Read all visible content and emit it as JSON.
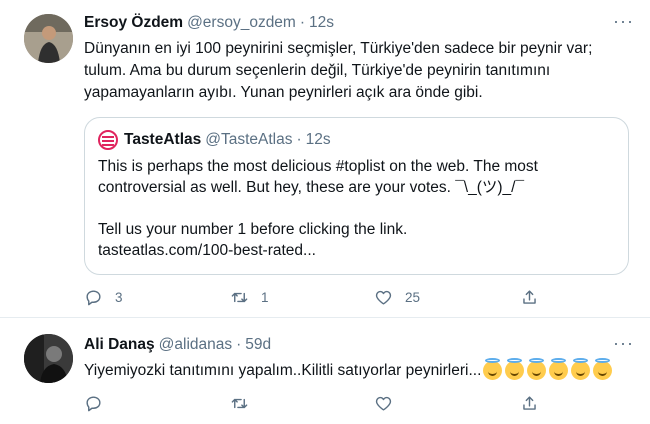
{
  "tweets": [
    {
      "author": {
        "name": "Ersoy Özdem",
        "handle": "@ersoy_ozdem",
        "time": "12s"
      },
      "separator": "·",
      "more": "···",
      "text": "Dünyanın en iyi 100 peynirini seçmişler, Türkiye'den sadece bir peynir var; tulum. Ama bu durum seçenlerin değil, Türkiye'de peynirin tanıtımını yapamayanların ayıbı. Yunan peynirleri açık ara önde gibi.",
      "quote": {
        "author": {
          "name": "TasteAtlas",
          "handle": "@TasteAtlas",
          "time": "12s"
        },
        "lines": [
          "This is perhaps the most delicious #toplist on the web. The most",
          "controversial as well. But hey, these are your votes. ¯\\_(ツ)_/¯",
          "",
          "Tell us your number 1 before clicking the link.",
          "tasteatlas.com/100-best-rated..."
        ]
      },
      "actions": {
        "replies": "3",
        "retweets": "1",
        "likes": "25"
      },
      "icons": [
        "reply-icon",
        "retweet-icon",
        "like-icon",
        "share-icon"
      ]
    },
    {
      "author": {
        "name": "Ali Danaş",
        "handle": "@alidanas",
        "time": "59d"
      },
      "separator": "·",
      "more": "···",
      "text": "Yiyemiyozki tanıtımını yapalım..Kilitli satıyorlar peynirleri...",
      "emoji_count": 6,
      "emoji_icon": "smiling-face-with-halo-icon",
      "actions": {
        "replies": "",
        "retweets": "",
        "likes": ""
      }
    }
  ],
  "colors": {
    "text": "#0f1419",
    "muted": "#5b7083",
    "border": "#cfd9de",
    "logo": "#e0245e"
  }
}
